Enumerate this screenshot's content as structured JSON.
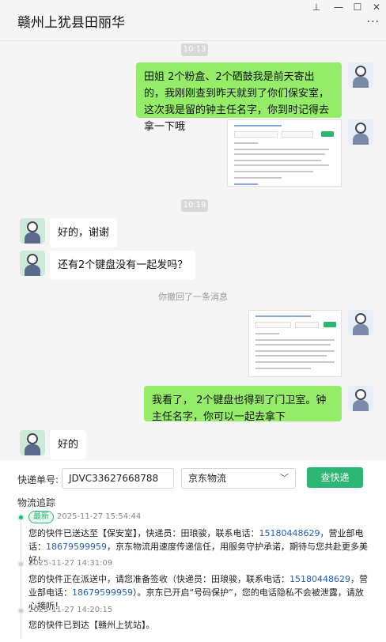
{
  "window": {
    "title": "赣州上犹县田丽华",
    "pin": "⊥",
    "minimize": "—",
    "maximize": "☐",
    "close": "✕",
    "more": "···"
  },
  "chat": {
    "time1": "10:13",
    "msg1": "田姐  2个粉盒、2个硒鼓我是前天寄出的，我刚刚查到昨天就到了你们保安室，这次我是留的钟主任名字，你到时记得去拿一下哦",
    "time2": "10:19",
    "msg2": "好的，谢谢",
    "msg3": "还有2个键盘没有一起发吗？",
    "recall": "你撤回了一条消息",
    "msg4": "我看了，  2个键盘也得到了门卫室。钟主任名字，你可以一起去拿下",
    "msg5": "好的"
  },
  "tracking": {
    "label": "快递单号:",
    "number": "JDVC33627668788",
    "carrier": "京东物流",
    "chevron": "﹀",
    "query_btn": "查快递",
    "section": "物流追踪",
    "latest_badge": "最新",
    "events": [
      {
        "time": "2025-11-27 15:54:44",
        "pre": "您的快件已送达至【保安室】，快递员：田琅骏，联系电话：",
        "phone1": "15180448629",
        "mid": "，营业部电话：",
        "phone2": "18679599959",
        "post": "，京东物流用速度传递信任，用服务守护承诺，期待与您共赴更多美好！"
      },
      {
        "time": "2025-11-27 14:31:09",
        "pre": "您的快件正在派送中，请您准备签收（快递员：田琅骏，联系电话：",
        "phone1": "15180448629",
        "mid": "，营业部电话：",
        "phone2": "18679599959",
        "post": "）。京东已开启“号码保护”，您的电话隐私不会被泄露，请放心接听！"
      },
      {
        "time": "2025-11-27 14:20:15",
        "text": "您的快件已到达【赣州上犹站】。"
      }
    ]
  },
  "colors": {
    "accent": "#2bb673",
    "bubble_me": "#95ec69",
    "link": "#1f5fbf"
  }
}
